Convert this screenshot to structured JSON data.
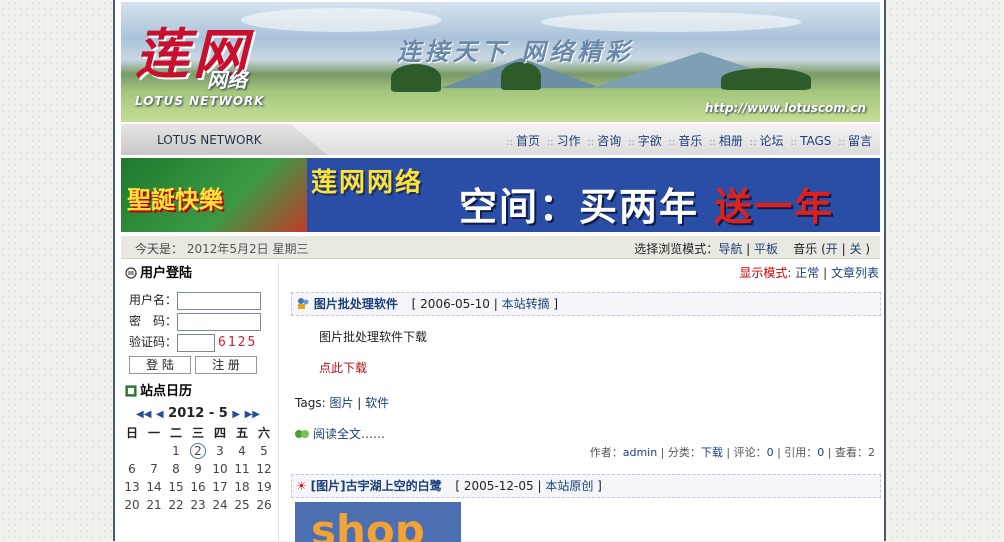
{
  "header": {
    "logo_cn": "莲网",
    "logo_sub": "网络",
    "logo_en": "LOTUS NETWORK",
    "slogan": "连接天下 网络精彩",
    "url": "http://www.lotuscom.cn"
  },
  "nav": {
    "brand": "LOTUS NETWORK",
    "items": [
      "首页",
      "习作",
      "咨询",
      "字欲",
      "音乐",
      "相册",
      "论坛",
      "TAGS",
      "留言"
    ]
  },
  "banner": {
    "xmas": "聖誕快樂",
    "brand": "莲网网络",
    "main_a": "空间：买两年",
    "main_b": "送一年"
  },
  "datebar": {
    "today_label": "今天是：",
    "today_value": "2012年5月2日 星期三",
    "mode_label": "选择浏览模式：",
    "mode_nav": "导航",
    "mode_flat": "平板",
    "music_label": "音乐 (",
    "music_on": "开",
    "music_off": "关",
    "music_close": ")"
  },
  "login": {
    "title": "用户登陆",
    "user_label": "用户名：",
    "pass_label": "密　码：",
    "code_label": "验证码：",
    "captcha": "6125",
    "login_btn": "登 陆",
    "register_btn": "注 册"
  },
  "calendar": {
    "title": "站点日历",
    "month": "2012 - 5",
    "weekdays": [
      "日",
      "一",
      "二",
      "三",
      "四",
      "五",
      "六"
    ],
    "rows": [
      [
        "",
        "",
        "1",
        "2",
        "3",
        "4",
        "5"
      ],
      [
        "6",
        "7",
        "8",
        "9",
        "10",
        "11",
        "12"
      ],
      [
        "13",
        "14",
        "15",
        "16",
        "17",
        "18",
        "19"
      ],
      [
        "20",
        "21",
        "22",
        "23",
        "24",
        "25",
        "26"
      ]
    ],
    "highlight": "2"
  },
  "main": {
    "display_label": "显示模式:",
    "display_normal": "正常",
    "display_list": "文章列表",
    "post1": {
      "title": "图片批处理软件",
      "date": "2006-05-10",
      "source": "本站转摘",
      "body": "图片批处理软件下载",
      "download": "点此下载",
      "tags_label": "Tags:",
      "tag1": "图片",
      "tag2": "软件",
      "read_more": "阅读全文……",
      "author_label": "作者：",
      "author": "admin",
      "cat_label": "分类：",
      "category": "下载",
      "comment_label": "评论：",
      "comments": "0",
      "ref_label": "引用：",
      "refs": "0",
      "view_label": "查看：",
      "views": "2"
    },
    "post2": {
      "title": "[图片]古宇湖上空的白鹭",
      "date": "2005-12-05",
      "source": "本站原创",
      "thumb_text": "shop"
    }
  }
}
